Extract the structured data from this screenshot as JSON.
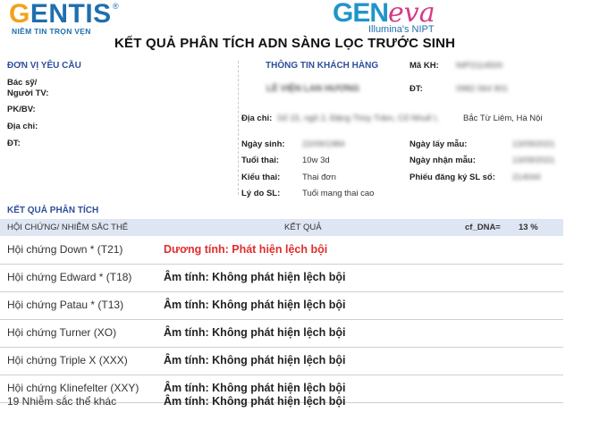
{
  "logos": {
    "gentis": {
      "g": "G",
      "rest": "ENTIS",
      "reg": "®",
      "tagline": "NIỀM TIN TRỌN VẸN"
    },
    "geneva": {
      "gen": "GEN",
      "eva": "eva",
      "sub": "Illumina's NIPT"
    }
  },
  "title": "KẾT QUẢ  PHÂN TÍCH ADN SÀNG LỌC TRƯỚC SINH",
  "unit": {
    "heading": "ĐƠN VỊ YÊU CẦU",
    "doctor_label_1": "Bác sỹ/",
    "doctor_label_2": "Người TV:",
    "hospital_label": "PK/BV:",
    "address_label": "Địa chỉ:",
    "phone_label": "ĐT:"
  },
  "client": {
    "heading": "THÔNG TIN KHÁCH HÀNG",
    "name": "LÊ VIỆN LAN HƯƠNG",
    "address_label": "Địa chỉ:",
    "address_blurred": "Số 15, ngõ 2, Đặng Thùy Trâm, Cổ Nhuế I,",
    "address_visible": "Bắc Từ Liêm, Hà Nội",
    "dob_label": "Ngày sinh:",
    "dob": "22/09/1984",
    "gest_label": "Tuổi thai:",
    "gest": "10w 3d",
    "preg_type_label": "Kiểu thai:",
    "preg_type": "Thai đơn",
    "reason_label": "Lý do SL:",
    "reason": "Tuổi mang thai cao",
    "code_label": "Mã KH:",
    "code": "NIP2114500",
    "phone_label": "ĐT:",
    "phone": "0982 064 901",
    "sample_date_label": "Ngày lấy mẫu:",
    "sample_date": "13/09/2021",
    "received_label": "Ngày nhận mẫu:",
    "received": "13/09/2021",
    "form_no_label": "Phiếu đăng ký SL số:",
    "form_no": "214044"
  },
  "results": {
    "heading": "KẾT QUẢ PHÂN TÍCH",
    "col_syndrome": "HỘI CHỨNG/ NHIỄM SẮC THỂ",
    "col_result": "KẾT QUẢ",
    "cf_label": "cf_DNA=",
    "cf_value": "13  %",
    "rows": [
      {
        "name": "Hội chứng Down * (T21)",
        "result": "Dương tính: Phát hiện lệch bội",
        "positive": true
      },
      {
        "name": "Hội chứng Edward * (T18)",
        "result": "Âm tính: Không phát hiện lệch bội",
        "positive": false
      },
      {
        "name": "Hội chứng Patau * (T13)",
        "result": "Âm tính: Không phát hiện lệch bội",
        "positive": false
      },
      {
        "name": "Hội chứng Turner (XO)",
        "result": "Âm tính: Không phát hiện lệch bội",
        "positive": false
      },
      {
        "name": "Hội chứng Triple X (XXX)",
        "result": "Âm tính: Không phát hiện lệch bội",
        "positive": false
      },
      {
        "name": "Hội chứng Klinefelter (XXY)",
        "result": "Âm tính: Không phát hiện lệch bội",
        "positive": false
      },
      {
        "name": "19 Nhiễm sắc thể khác",
        "result": "Âm tính: Không phát hiện lệch bội",
        "positive": false
      }
    ]
  },
  "colors": {
    "brand_blue": "#1f6fae",
    "section_blue": "#2e4f9c",
    "positive_red": "#e12d2d",
    "header_band": "#dfe6f3"
  }
}
